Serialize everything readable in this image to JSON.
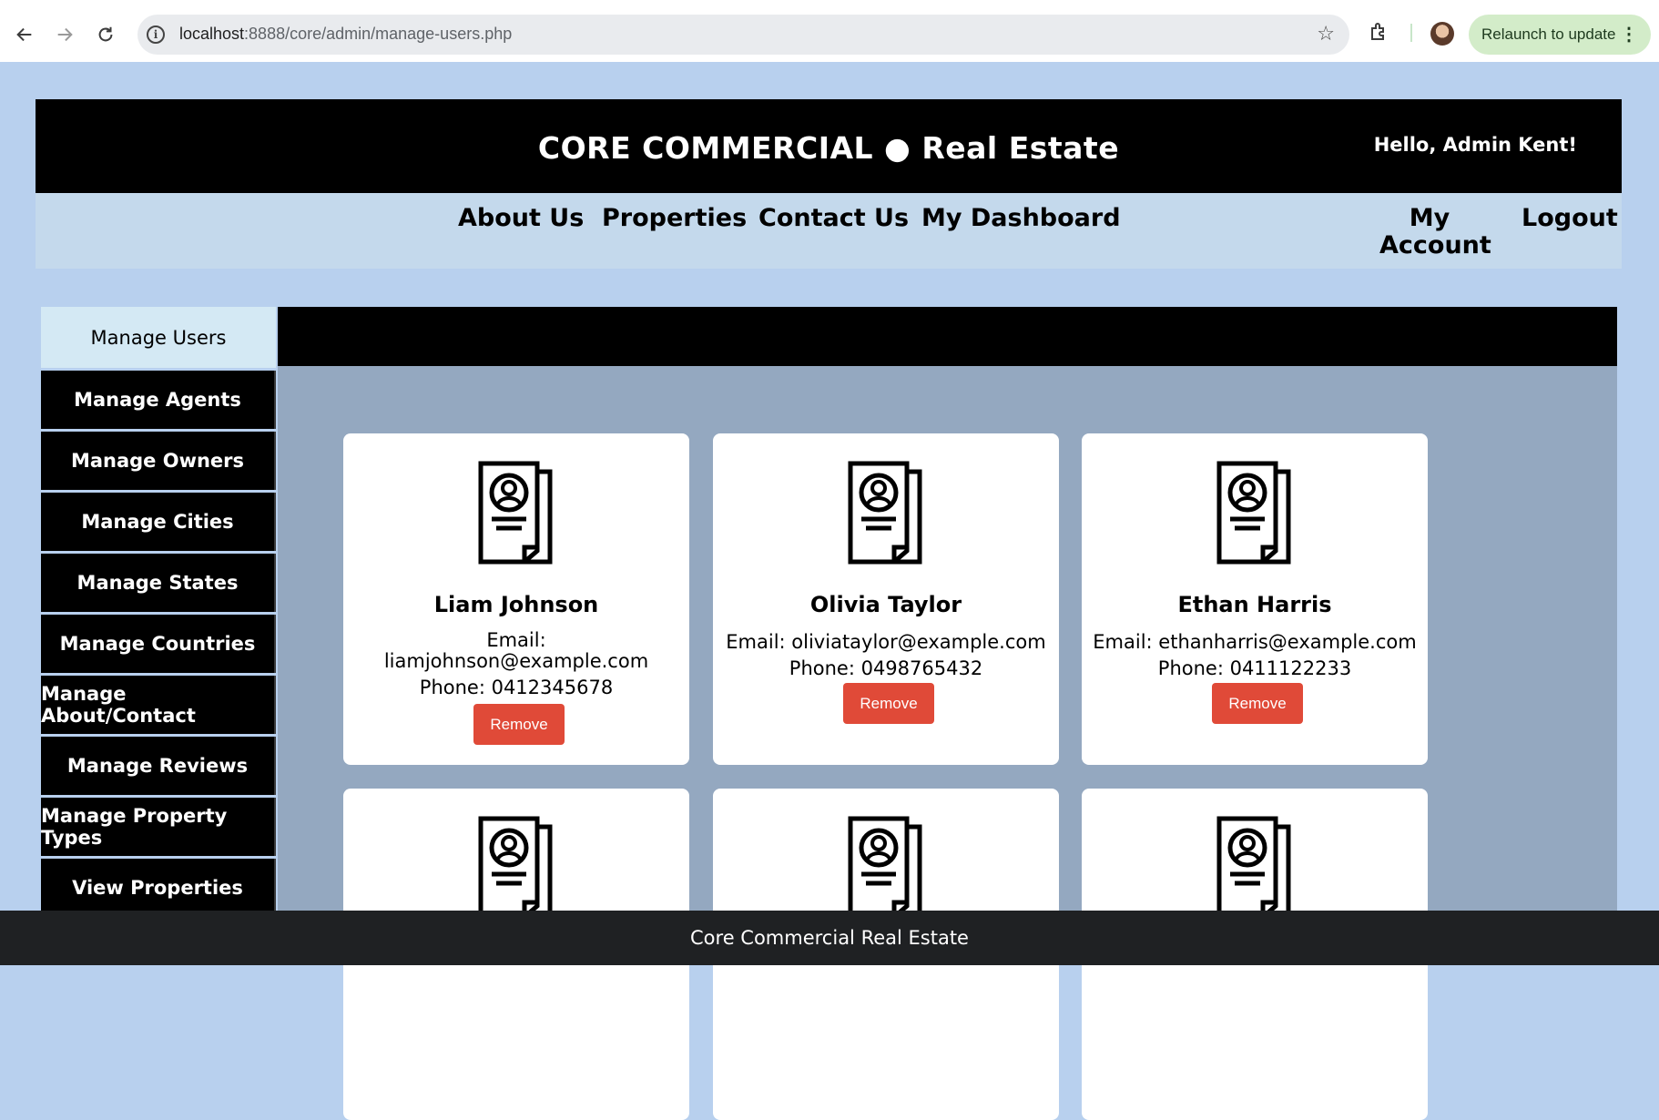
{
  "browser": {
    "url_host": "localhost",
    "url_path": ":8888/core/admin/manage-users.php",
    "relaunch_label": "Relaunch to update"
  },
  "header": {
    "site_title": "CORE COMMERCIAL ● Real Estate",
    "greeting": "Hello, Admin Kent!"
  },
  "nav": {
    "about": "About Us",
    "properties": "Properties",
    "contact": "Contact Us",
    "dashboard": "My Dashboard",
    "account_line1": "My",
    "account_line2": "Account",
    "logout": "Logout"
  },
  "sidebar": {
    "items": [
      {
        "label": "Manage Users"
      },
      {
        "label": "Manage Agents"
      },
      {
        "label": "Manage Owners"
      },
      {
        "label": "Manage Cities"
      },
      {
        "label": "Manage States"
      },
      {
        "label": "Manage Countries"
      },
      {
        "label": "Manage About/Contact"
      },
      {
        "label": "Manage Reviews"
      },
      {
        "label": "Manage Property Types"
      },
      {
        "label": "View Properties"
      }
    ]
  },
  "users": [
    {
      "name": "Liam Johnson",
      "email_label": "Email:",
      "email": "liamjohnson@example.com",
      "phone": "Phone: 0412345678",
      "remove": "Remove"
    },
    {
      "name": "Olivia Taylor",
      "email_line": "Email: oliviataylor@example.com",
      "phone": "Phone: 0498765432",
      "remove": "Remove"
    },
    {
      "name": "Ethan Harris",
      "email_line": "Email: ethanharris@example.com",
      "phone": "Phone: 0411122233",
      "remove": "Remove"
    }
  ],
  "footer": {
    "text": "Core Commercial Real Estate"
  }
}
